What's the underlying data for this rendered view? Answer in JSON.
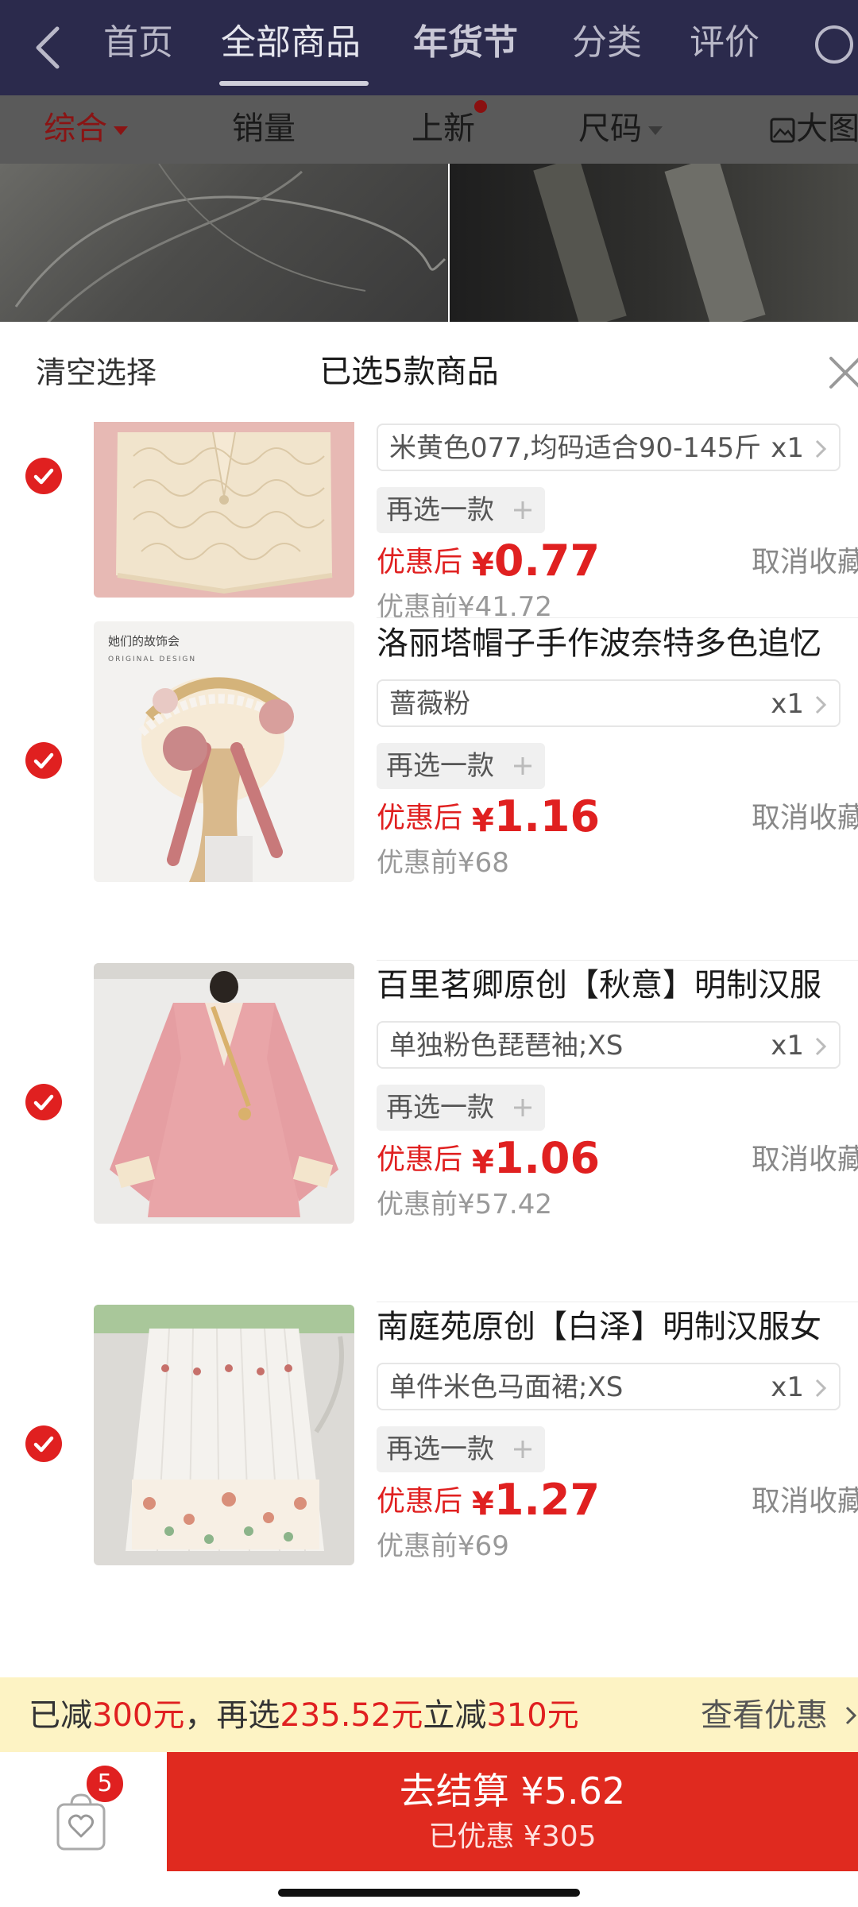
{
  "nav": {
    "tabs": [
      "首页",
      "全部商品",
      "年货节",
      "分类",
      "评价"
    ]
  },
  "filters": {
    "items": [
      "综合",
      "销量",
      "上新",
      "尺码",
      "大图"
    ]
  },
  "sheet": {
    "clear_label": "清空选择",
    "title": "已选5款商品"
  },
  "items": [
    {
      "title": "",
      "sku": "米黄色077,均码适合90-145斤",
      "qty": "x1",
      "reselect": "再选一款",
      "price_label": "优惠后",
      "price": "0.77",
      "cancel": "取消收藏",
      "orig": "优惠前¥41.72"
    },
    {
      "title": "洛丽塔帽子手作波奈特多色追忆",
      "sku": "蔷薇粉",
      "qty": "x1",
      "reselect": "再选一款",
      "price_label": "优惠后",
      "price": "1.16",
      "cancel": "取消收藏",
      "orig": "优惠前¥68"
    },
    {
      "title": "百里茗卿原创【秋意】明制汉服",
      "sku": "单独粉色琵琶袖;XS",
      "qty": "x1",
      "reselect": "再选一款",
      "price_label": "优惠后",
      "price": "1.06",
      "cancel": "取消收藏",
      "orig": "优惠前¥57.42"
    },
    {
      "title": "南庭苑原创【白泽】明制汉服女",
      "sku": "单件米色马面裙;XS",
      "qty": "x1",
      "reselect": "再选一款",
      "price_label": "优惠后",
      "price": "1.27",
      "cancel": "取消收藏",
      "orig": "优惠前¥69"
    }
  ],
  "thumb2_text": {
    "line1": "她们的故饰会",
    "line2": "ORIGINAL DESIGN"
  },
  "promo": {
    "p1": "已减",
    "v1": "300元",
    "p2": "，再选",
    "v2": "235.52元",
    "p3": "立减",
    "v3": "310元",
    "link": "查看优惠"
  },
  "checkout": {
    "badge": "5",
    "main": "去结算 ¥5.62",
    "sub": "已优惠 ¥305"
  },
  "colors": {
    "accent": "#e02020",
    "nav_bg": "#2b2a4c",
    "promo_bg": "#fdf3c4",
    "checkout_bg": "#e02a1f"
  }
}
